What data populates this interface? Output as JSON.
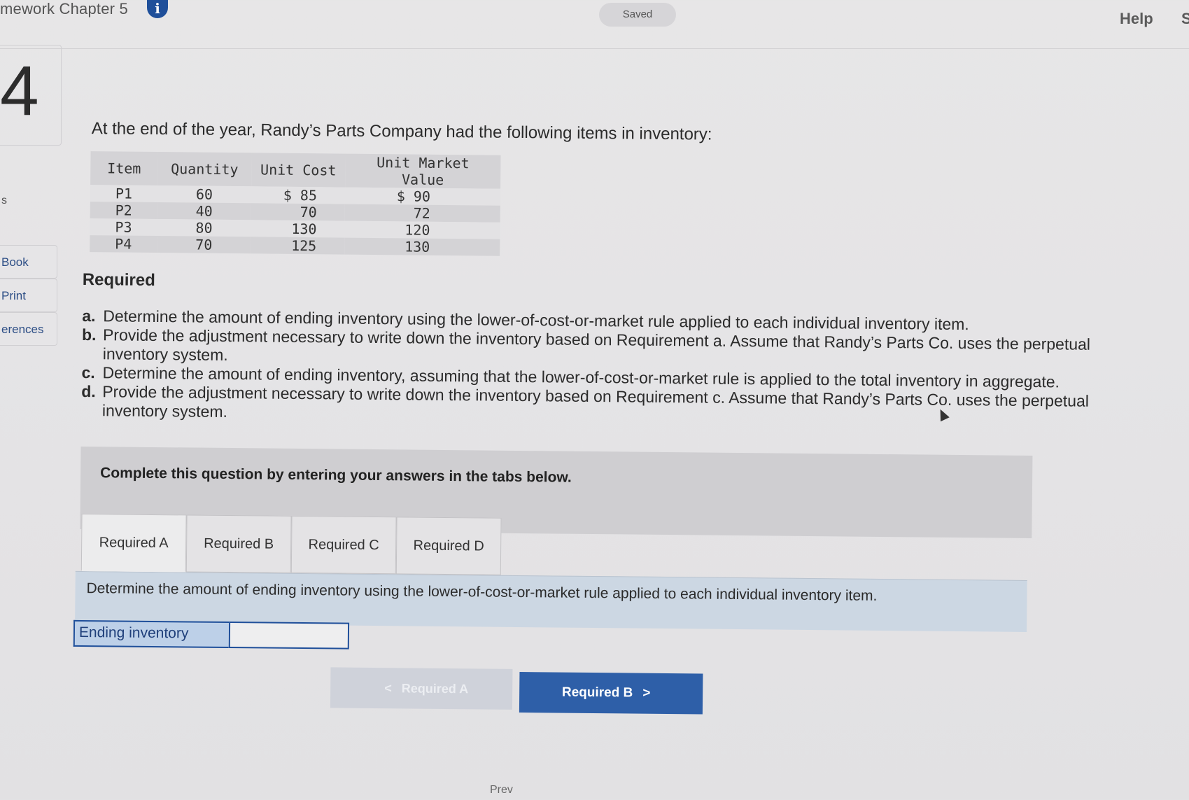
{
  "header": {
    "title": "mework Chapter 5",
    "info_glyph": "i",
    "saved_label": "Saved",
    "help_label": "Help",
    "edge_letter": "S"
  },
  "question": {
    "number": "4"
  },
  "sidebar": {
    "fragment": "s",
    "items": [
      {
        "label": "Book"
      },
      {
        "label": "Print"
      },
      {
        "label": "erences"
      }
    ]
  },
  "problem": {
    "intro": "At the end of the year, Randy’s Parts Company had the following items in inventory:",
    "table": {
      "headers": [
        "Item",
        "Quantity",
        "Unit Cost",
        "Unit Market Value"
      ],
      "rows": [
        [
          "P1",
          "60",
          "$ 85",
          "$ 90"
        ],
        [
          "P2",
          "40",
          "70",
          "72"
        ],
        [
          "P3",
          "80",
          "130",
          "120"
        ],
        [
          "P4",
          "70",
          "125",
          "130"
        ]
      ]
    },
    "required_heading": "Required",
    "requirements": [
      {
        "label": "a.",
        "text": "Determine the amount of ending inventory using the lower-of-cost-or-market rule applied to each individual inventory item."
      },
      {
        "label": "b.",
        "text": "Provide the adjustment necessary to write down the inventory based on Requirement a. Assume that Randy’s Parts Co. uses the perpetual inventory system."
      },
      {
        "label": "c.",
        "text": "Determine the amount of ending inventory, assuming that the lower-of-cost-or-market rule is applied to the total inventory in aggregate."
      },
      {
        "label": "d.",
        "text": "Provide the adjustment necessary to write down the inventory based on Requirement c. Assume that Randy’s Parts Co. uses the perpetual inventory system."
      }
    ]
  },
  "answer_area": {
    "instruction": "Complete this question by entering your answers in the tabs below.",
    "tabs": [
      {
        "label": "Required A"
      },
      {
        "label": "Required B"
      },
      {
        "label": "Required C"
      },
      {
        "label": "Required D"
      }
    ],
    "active_tab_text": "Determine the amount of ending inventory using the lower-of-cost-or-market rule applied to each individual inventory item.",
    "field_label": "Ending inventory",
    "field_value": ""
  },
  "navigation": {
    "prev_label": "Required A",
    "next_label": "Required B",
    "prev_chevron": "<",
    "next_chevron": ">",
    "bottom_fragment": "Prev"
  }
}
